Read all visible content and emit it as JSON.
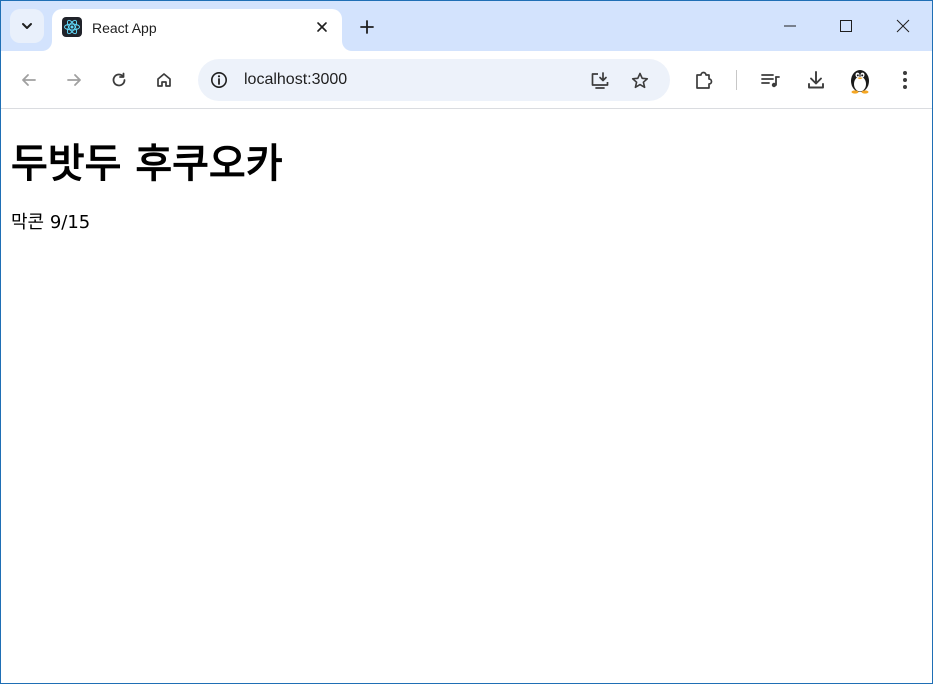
{
  "browser": {
    "tab": {
      "title": "React App",
      "favicon": "react-logo-icon"
    },
    "address_bar": {
      "url": "localhost:3000"
    },
    "colors": {
      "tabstrip": "#d3e3fd",
      "omnibox": "#edf2fa",
      "window_border": "#1f6fb5"
    }
  },
  "page": {
    "heading": "두밧두 후쿠오카",
    "text": "막콘 9/15"
  }
}
